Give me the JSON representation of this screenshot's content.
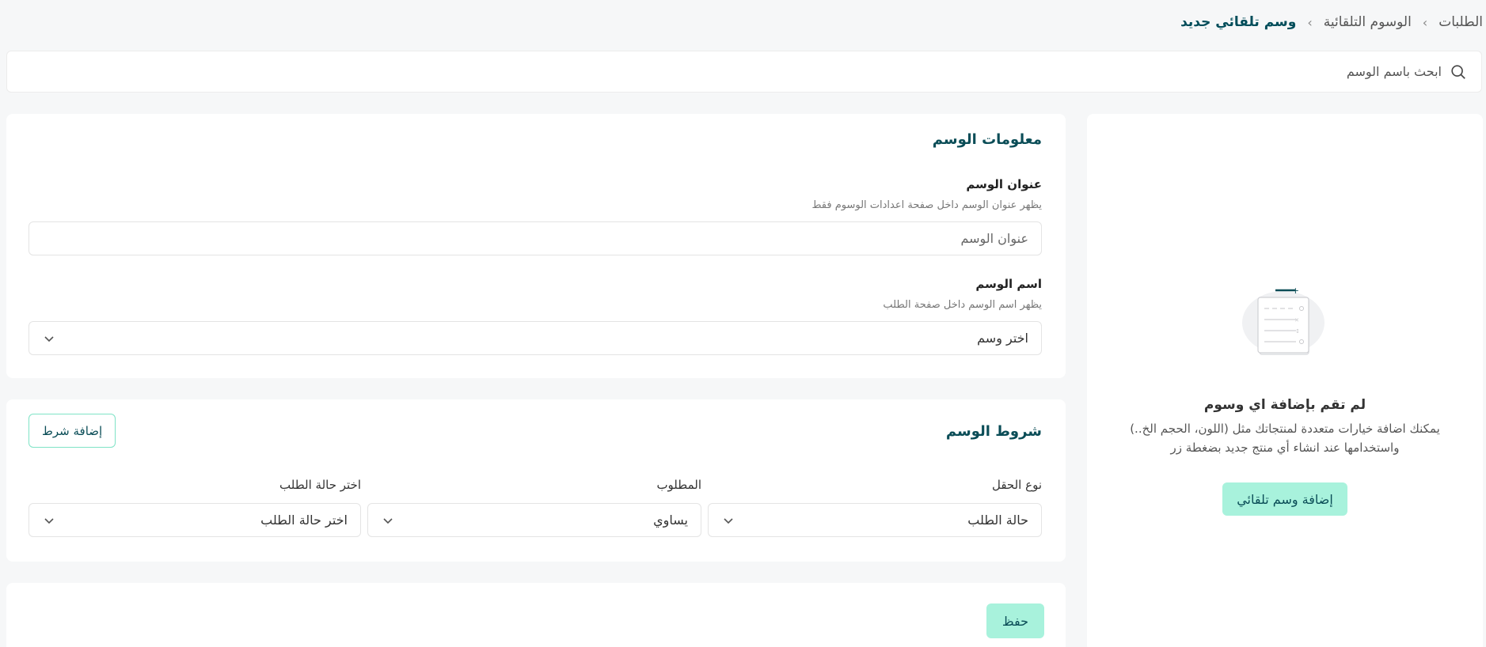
{
  "breadcrumb": {
    "items": [
      "الطلبات",
      "الوسوم التلقائية",
      "وسم تلقائي جديد"
    ]
  },
  "search": {
    "placeholder": "ابحث باسم الوسم",
    "icon": "search-icon"
  },
  "tag_info": {
    "title": "معلومات الوسم",
    "tag_title_label": "عنوان الوسم",
    "tag_title_hint": "يظهر عنوان الوسم داخل صفحة اعدادات الوسوم فقط",
    "tag_title_placeholder": "عنوان الوسم",
    "tag_name_label": "اسم الوسم",
    "tag_name_hint": "يظهر اسم الوسم داخل صفحة الطلب",
    "tag_name_select": "اختر وسم"
  },
  "conditions": {
    "title": "شروط الوسم",
    "add_button": "إضافة شرط",
    "field_type_label": "نوع الحقل",
    "field_type_value": "حالة الطلب",
    "operator_label": "المطلوب",
    "operator_value": "يساوي",
    "status_label": "اختر حالة الطلب",
    "status_value": "اختر حالة الطلب"
  },
  "actions": {
    "save_label": "حفظ"
  },
  "empty_state": {
    "title": "لم تقم بإضافة اي وسوم",
    "description": "يمكنك اضافة خيارات متعددة لمنتجاتك مثل (اللون، الحجم الخ..) واستخدامها عند انشاء أي منتج جديد بضغطة زر",
    "button_label": "إضافة وسم تلقائي",
    "illustration": "empty-list-illustration"
  },
  "colors": {
    "accent_soft": "#a8f2dc",
    "brand_dark": "#0b4d57",
    "border_accent": "#7fe3c6",
    "background": "#f6f7f8"
  }
}
